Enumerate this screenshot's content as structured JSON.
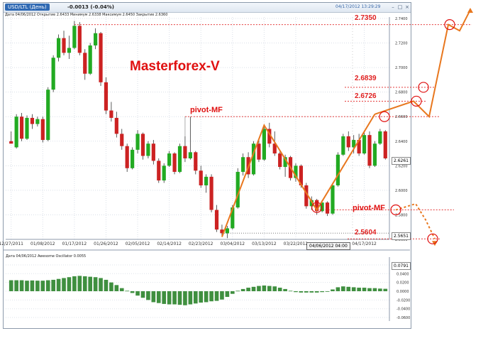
{
  "window": {
    "symbol_label": "USD/LTL (День)",
    "change_text": "-0.0013 (-0.04%)",
    "datetime": "04/17/2012 13:29:29",
    "info_line": "Дата 04/06/2012  Открытие 2.6433  Минимум 2.6338  Максимум 2.6450  Закрытие 2.6360",
    "min_btn": "–",
    "max_btn": "□",
    "close_btn": "×"
  },
  "annotations": {
    "brand": "Masterforex-V",
    "pivot_top": "pivot-MF",
    "pivot_bottom": "pivot-MF",
    "levels": [
      "2.7350",
      "2.6839",
      "2.6726",
      "2.5604"
    ]
  },
  "price_tags": {
    "current": "2.6261",
    "crosshair_price": "2.5651",
    "crosshair_date": "04/06/2012 04:00"
  },
  "oscillator": {
    "info": "Дата 04/06/2012  Awesome Oscillator 0.0055",
    "value_tag": "0.0791"
  },
  "colors": {
    "bull": "#22aa22",
    "bear": "#cc2222",
    "accent": "#e8771e",
    "level": "#e02020"
  },
  "chart_data": [
    {
      "type": "candlestick",
      "title": "USD/LTL (День)",
      "y_ticks": [
        "2.7400",
        "2.7200",
        "2.7000",
        "2.6800",
        "2.6600",
        "2.6400",
        "2.6200",
        "2.6000",
        "2.5800",
        "2.5600"
      ],
      "x_ticks": [
        "12/27/2011",
        "01/08/2012",
        "01/17/2012",
        "01/26/2012",
        "02/05/2012",
        "02/14/2012",
        "02/23/2012",
        "03/04/2012",
        "03/13/2012",
        "03/22/2012",
        "04/17/2012"
      ],
      "ylim": [
        2.56,
        2.74
      ],
      "candles": [
        [
          2.64,
          2.648,
          2.638,
          2.638
        ],
        [
          2.635,
          2.662,
          2.634,
          2.66
        ],
        [
          2.66,
          2.663,
          2.64,
          2.642
        ],
        [
          2.642,
          2.661,
          2.641,
          2.659
        ],
        [
          2.659,
          2.662,
          2.65,
          2.654
        ],
        [
          2.654,
          2.66,
          2.652,
          2.658
        ],
        [
          2.658,
          2.66,
          2.639,
          2.641
        ],
        [
          2.641,
          2.684,
          2.64,
          2.682
        ],
        [
          2.682,
          2.71,
          2.68,
          2.708
        ],
        [
          2.708,
          2.727,
          2.705,
          2.724
        ],
        [
          2.724,
          2.73,
          2.71,
          2.712
        ],
        [
          2.712,
          2.726,
          2.707,
          2.716
        ],
        [
          2.716,
          2.738,
          2.715,
          2.734
        ],
        [
          2.734,
          2.737,
          2.71,
          2.712
        ],
        [
          2.712,
          2.715,
          2.69,
          2.695
        ],
        [
          2.695,
          2.72,
          2.694,
          2.718
        ],
        [
          2.718,
          2.732,
          2.715,
          2.728
        ],
        [
          2.728,
          2.729,
          2.685,
          2.688
        ],
        [
          2.688,
          2.692,
          2.662,
          2.665
        ],
        [
          2.665,
          2.672,
          2.656,
          2.659
        ],
        [
          2.659,
          2.664,
          2.643,
          2.646
        ],
        [
          2.646,
          2.65,
          2.633,
          2.636
        ],
        [
          2.636,
          2.638,
          2.615,
          2.618
        ],
        [
          2.618,
          2.635,
          2.617,
          2.633
        ],
        [
          2.633,
          2.649,
          2.63,
          2.646
        ],
        [
          2.646,
          2.647,
          2.625,
          2.628
        ],
        [
          2.628,
          2.64,
          2.626,
          2.638
        ],
        [
          2.638,
          2.641,
          2.621,
          2.624
        ],
        [
          2.624,
          2.626,
          2.606,
          2.608
        ],
        [
          2.608,
          2.622,
          2.606,
          2.62
        ],
        [
          2.62,
          2.632,
          2.619,
          2.63
        ],
        [
          2.63,
          2.631,
          2.613,
          2.615
        ],
        [
          2.615,
          2.638,
          2.614,
          2.636
        ],
        [
          2.636,
          2.644,
          2.623,
          2.626
        ],
        [
          2.626,
          2.66,
          2.625,
          2.631
        ],
        [
          2.631,
          2.632,
          2.613,
          2.616
        ],
        [
          2.616,
          2.62,
          2.602,
          2.604
        ],
        [
          2.604,
          2.613,
          2.598,
          2.611
        ],
        [
          2.611,
          2.613,
          2.582,
          2.584
        ],
        [
          2.584,
          2.588,
          2.566,
          2.568
        ],
        [
          2.568,
          2.572,
          2.562,
          2.565
        ],
        [
          2.565,
          2.571,
          2.561,
          2.569
        ],
        [
          2.569,
          2.588,
          2.568,
          2.586
        ],
        [
          2.586,
          2.618,
          2.585,
          2.615
        ],
        [
          2.615,
          2.63,
          2.612,
          2.627
        ],
        [
          2.627,
          2.631,
          2.61,
          2.613
        ],
        [
          2.613,
          2.64,
          2.612,
          2.638
        ],
        [
          2.638,
          2.642,
          2.623,
          2.625
        ],
        [
          2.625,
          2.653,
          2.624,
          2.65
        ],
        [
          2.65,
          2.655,
          2.635,
          2.638
        ],
        [
          2.638,
          2.648,
          2.628,
          2.63
        ],
        [
          2.63,
          2.632,
          2.617,
          2.619
        ],
        [
          2.619,
          2.629,
          2.611,
          2.627
        ],
        [
          2.627,
          2.628,
          2.608,
          2.61
        ],
        [
          2.61,
          2.622,
          2.607,
          2.62
        ],
        [
          2.62,
          2.621,
          2.602,
          2.604
        ],
        [
          2.604,
          2.606,
          2.585,
          2.587
        ],
        [
          2.587,
          2.595,
          2.584,
          2.592
        ],
        [
          2.592,
          2.593,
          2.58,
          2.583
        ],
        [
          2.583,
          2.592,
          2.582,
          2.59
        ],
        [
          2.59,
          2.591,
          2.579,
          2.581
        ],
        [
          2.581,
          2.606,
          2.58,
          2.604
        ],
        [
          2.604,
          2.631,
          2.603,
          2.629
        ],
        [
          2.629,
          2.646,
          2.628,
          2.644
        ],
        [
          2.644,
          2.648,
          2.632,
          2.635
        ],
        [
          2.635,
          2.645,
          2.63,
          2.641
        ],
        [
          2.641,
          2.646,
          2.628,
          2.63
        ],
        [
          2.63,
          2.647,
          2.629,
          2.645
        ],
        [
          2.645,
          2.648,
          2.618,
          2.62
        ],
        [
          2.62,
          2.64,
          2.619,
          2.638
        ],
        [
          2.638,
          2.65,
          2.637,
          2.648
        ],
        [
          2.648,
          2.649,
          2.625,
          2.626
        ]
      ]
    },
    {
      "type": "bar",
      "title": "Awesome Oscillator",
      "y_ticks": [
        "0.0600",
        "0.0400",
        "0.0200",
        "0.0000",
        "-0.0200",
        "-0.0400",
        "-0.0600"
      ],
      "ylim": [
        -0.068,
        0.068
      ],
      "values": [
        0.025,
        0.025,
        0.025,
        0.024,
        0.0245,
        0.024,
        0.024,
        0.025,
        0.026,
        0.028,
        0.03,
        0.032,
        0.034,
        0.035,
        0.034,
        0.033,
        0.032,
        0.03,
        0.026,
        0.02,
        0.014,
        0.007,
        0.001,
        -0.004,
        -0.01,
        -0.015,
        -0.02,
        -0.025,
        -0.027,
        -0.029,
        -0.03,
        -0.03,
        -0.031,
        -0.032,
        -0.03,
        -0.028,
        -0.026,
        -0.025,
        -0.023,
        -0.022,
        -0.019,
        -0.013,
        -0.006,
        0.001,
        0.005,
        0.008,
        0.01,
        0.012,
        0.013,
        0.012,
        0.011,
        0.008,
        0.005,
        0.001,
        -0.002,
        -0.003,
        -0.003,
        -0.003,
        -0.003,
        -0.002,
        -0.001,
        0.004,
        0.009,
        0.011,
        0.01,
        0.009,
        0.008,
        0.008,
        0.007,
        0.007,
        0.006,
        0.0055
      ]
    }
  ]
}
